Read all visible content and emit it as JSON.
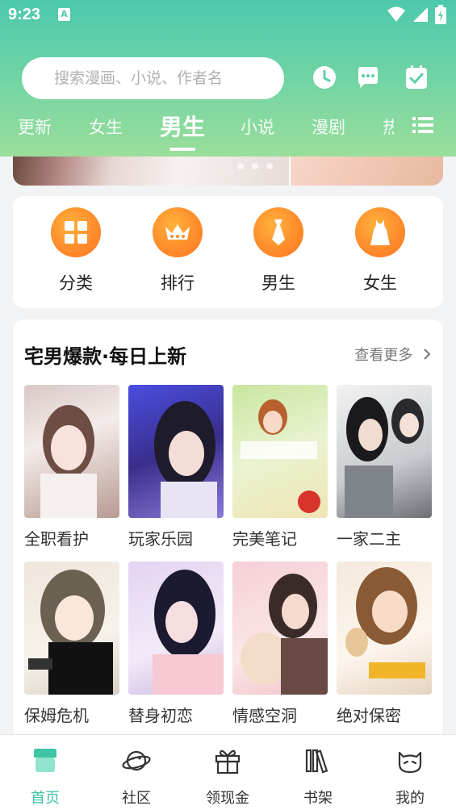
{
  "status_bar": {
    "time": "9:23",
    "sim_letter": "A"
  },
  "search": {
    "placeholder": "搜索漫画、小说、作者名"
  },
  "tabs": [
    {
      "label": "更新"
    },
    {
      "label": "女生"
    },
    {
      "label": "男生"
    },
    {
      "label": "小说"
    },
    {
      "label": "漫剧"
    },
    {
      "label": "热"
    }
  ],
  "active_tab": "男生",
  "quick_entries": [
    {
      "label": "分类",
      "icon": "grid-icon"
    },
    {
      "label": "排行",
      "icon": "crown-icon"
    },
    {
      "label": "男生",
      "icon": "tie-icon"
    },
    {
      "label": "女生",
      "icon": "dress-icon"
    }
  ],
  "section": {
    "title": "宅男爆款·每日上新",
    "more": "查看更多",
    "items": [
      {
        "title": "全职看护"
      },
      {
        "title": "玩家乐园"
      },
      {
        "title": "完美笔记"
      },
      {
        "title": "一家二主"
      },
      {
        "title": "保姆危机"
      },
      {
        "title": "替身初恋"
      },
      {
        "title": "情感空洞"
      },
      {
        "title": "绝对保密"
      }
    ]
  },
  "bottom_nav": [
    {
      "label": "首页",
      "icon": "home-icon",
      "active": true
    },
    {
      "label": "社区",
      "icon": "planet-icon"
    },
    {
      "label": "领现金",
      "icon": "gift-icon"
    },
    {
      "label": "书架",
      "icon": "bookshelf-icon"
    },
    {
      "label": "我的",
      "icon": "cat-face-icon"
    }
  ],
  "colors": {
    "accent": "#3fc4a6",
    "orange": "#ff8a2a"
  }
}
